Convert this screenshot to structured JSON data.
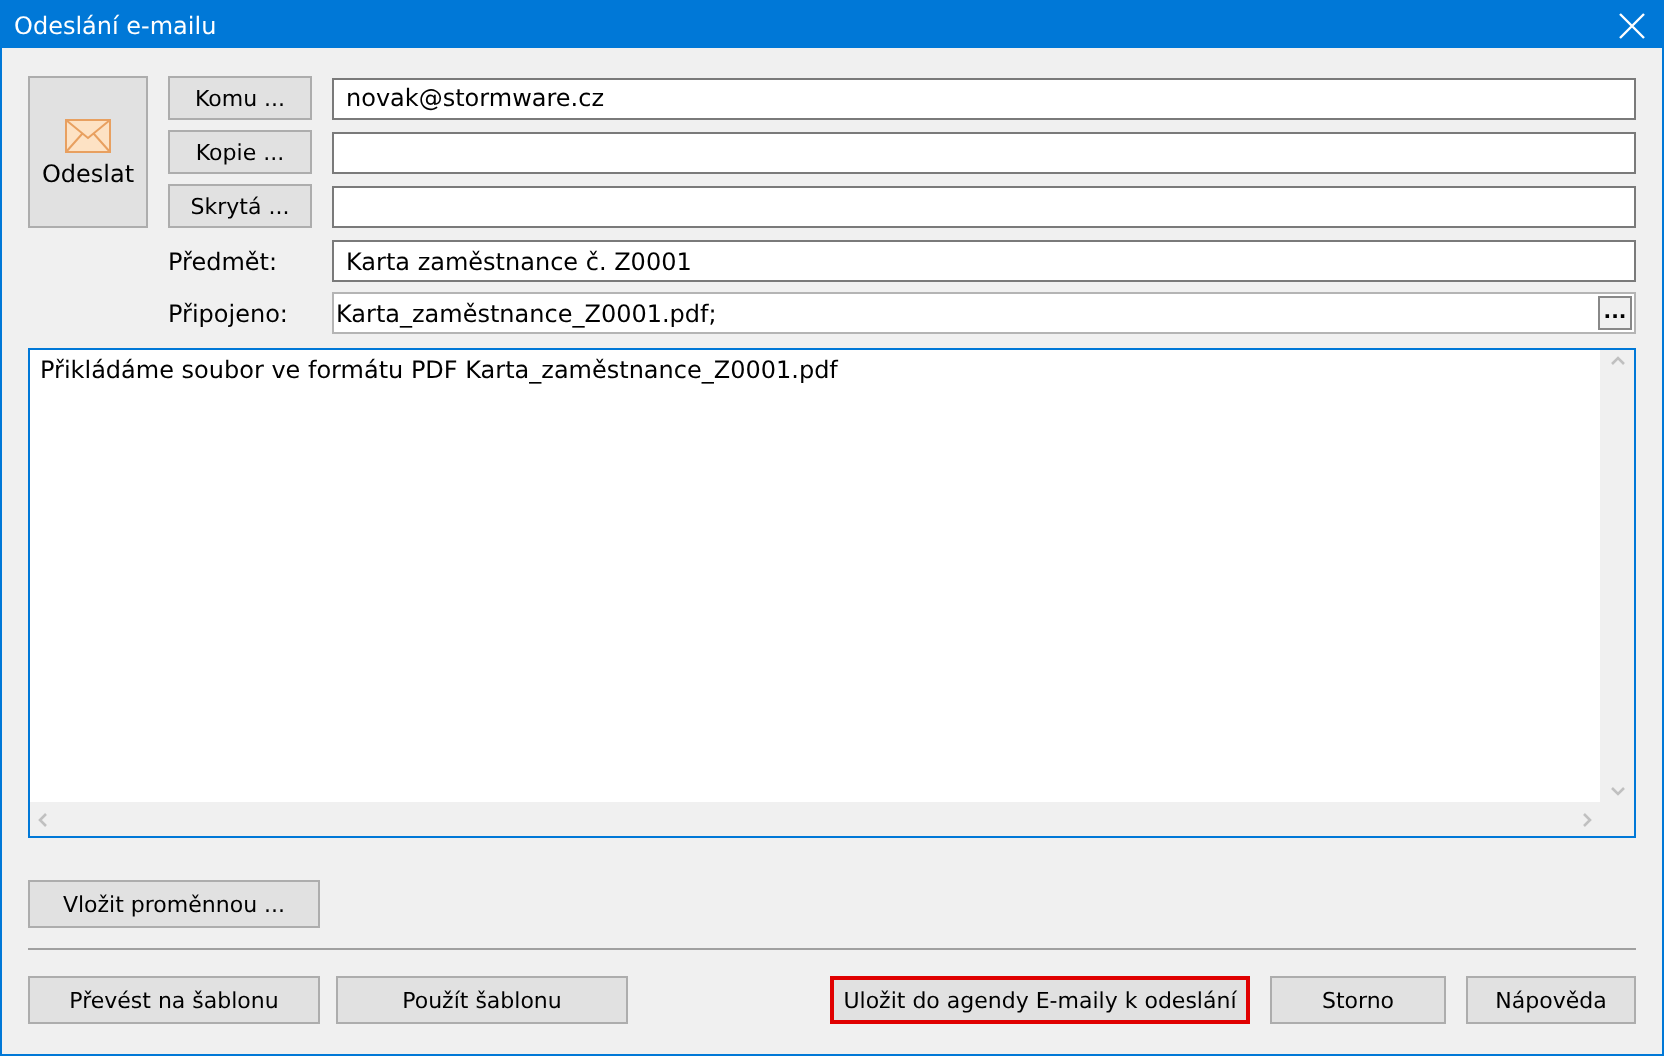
{
  "window": {
    "title": "Odeslání e-mailu"
  },
  "send_button": {
    "label": "Odeslat"
  },
  "address_rows": [
    {
      "button": "Komu ...",
      "value": "novak@stormware.cz"
    },
    {
      "button": "Kopie ...",
      "value": ""
    },
    {
      "button": "Skrytá ...",
      "value": ""
    }
  ],
  "subject": {
    "label": "Předmět:",
    "value": "Karta zaměstnance č. Z0001"
  },
  "attachment": {
    "label": "Připojeno:",
    "value": "Karta_zaměstnance_Z0001.pdf;",
    "browse_button": "..."
  },
  "body": {
    "text": "Přikládáme soubor ve formátu PDF Karta_zaměstnance_Z0001.pdf"
  },
  "insert_variable_button": "Vložit proměnnou ...",
  "footer_left_buttons": [
    {
      "label": "Převést na šablonu",
      "highlighted": false
    },
    {
      "label": "Použít šablonu",
      "highlighted": false
    }
  ],
  "footer_right_buttons": [
    {
      "label": "Uložit do agendy E-maily k odeslání",
      "highlighted": true
    },
    {
      "label": "Storno",
      "highlighted": false
    },
    {
      "label": "Nápověda",
      "highlighted": false
    }
  ]
}
